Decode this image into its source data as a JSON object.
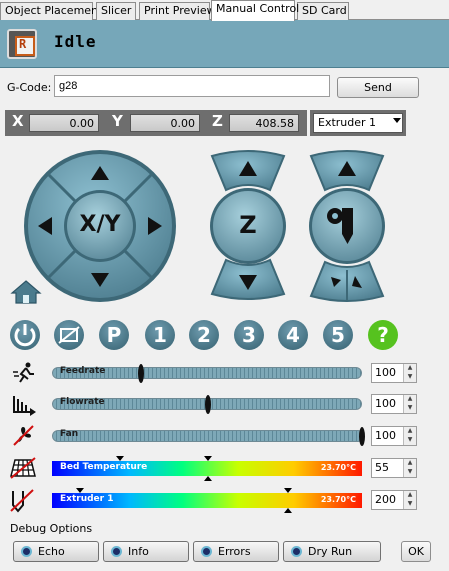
{
  "tabs": [
    "Object Placement",
    "Slicer",
    "Print Preview",
    "Manual Control",
    "SD Card"
  ],
  "active_tab": "Manual Control",
  "status": "Idle",
  "gcode": {
    "label": "G-Code:",
    "value": "g28",
    "send_label": "Send"
  },
  "position": {
    "x_label": "X",
    "x": "0.00",
    "y_label": "Y",
    "y": "0.00",
    "z_label": "Z",
    "z": "408.58"
  },
  "extruder_select": {
    "value": "Extruder 1"
  },
  "jog": {
    "xy_label": "X/Y",
    "z_label": "Z"
  },
  "function_buttons": [
    "1",
    "2",
    "3",
    "4",
    "5"
  ],
  "fan": {
    "label": "Fan",
    "value": "100",
    "level": 1.0
  },
  "rows": {
    "feedrate": {
      "label": "Feedrate",
      "value": "100",
      "level": 0.28
    },
    "flowrate": {
      "label": "Flowrate",
      "value": "100",
      "level": 0.5
    },
    "bed": {
      "label": "Bed Temperature",
      "current": "23.70°C",
      "target": "55"
    },
    "extruder": {
      "label": "Extruder 1",
      "current": "23.70°C",
      "target": "200"
    }
  },
  "debug": {
    "label": "Debug Options",
    "buttons": [
      "Echo",
      "Info",
      "Errors",
      "Dry Run"
    ],
    "ok_label": "OK"
  },
  "colors": {
    "header": "#76a7b9",
    "jog_button": "#6f9caf",
    "dark_ring": "#4a7686",
    "help": "#56c21f"
  }
}
